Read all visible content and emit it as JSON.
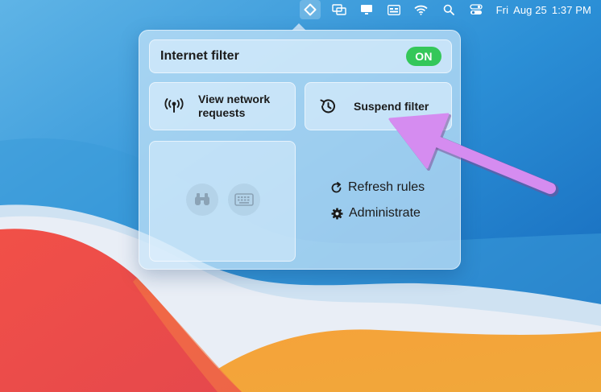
{
  "menubar": {
    "icons": [
      "filter-status-icon",
      "screen-mirroring-icon",
      "display-icon",
      "keyboard-input-icon",
      "wifi-icon",
      "spotlight-search-icon",
      "control-center-icon"
    ],
    "day": "Fri",
    "date": "Aug 25",
    "time": "1:37 PM"
  },
  "popover": {
    "filter": {
      "title": "Internet filter",
      "toggle_label": "ON",
      "toggle_color": "#34c759"
    },
    "tiles": {
      "network_label": "View network requests",
      "suspend_label": "Suspend filter"
    },
    "quick_icons": [
      "binoculars-icon",
      "keyboard-icon"
    ],
    "links": {
      "refresh": "Refresh rules",
      "administrate": "Administrate"
    }
  },
  "annotation": {
    "arrow_color": "#d58cf0"
  }
}
